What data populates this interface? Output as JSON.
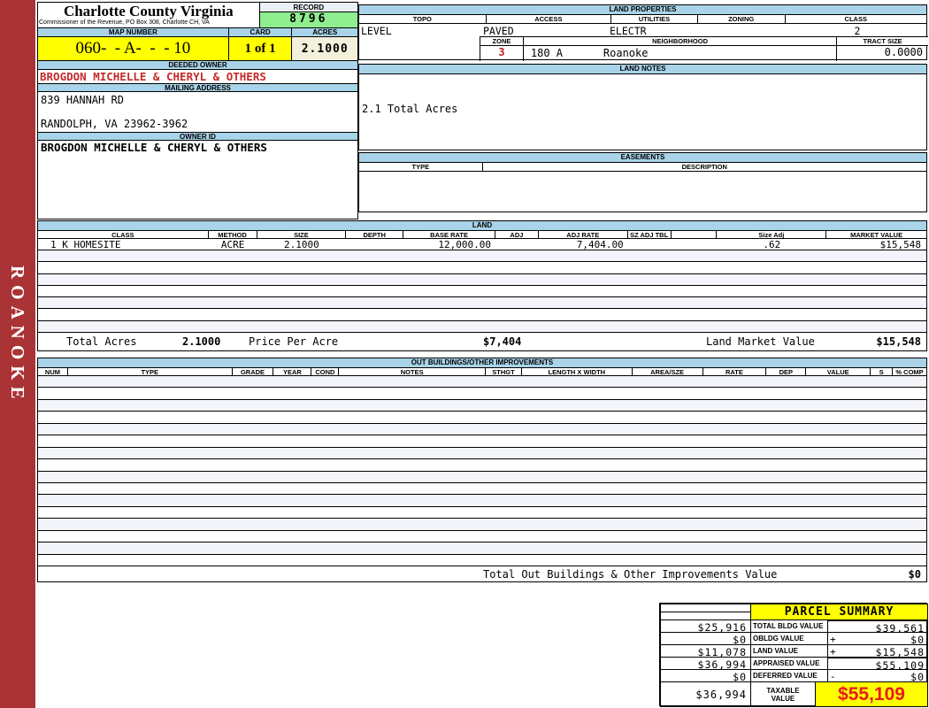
{
  "sidebar": {
    "label": "ROANOKE",
    "color": "#A93335"
  },
  "header": {
    "county": "Charlotte County Virginia",
    "commissioner": "Commissioner of the Revenue, PO Box 308, Charlotte CH, VA",
    "record_label": "RECORD",
    "record_value": "8796",
    "map_number_label": "MAP NUMBER",
    "map_number_value": "060-  - A-  -  - 10",
    "card_label": "CARD",
    "card_value": "1 of 1",
    "acres_label": "ACRES",
    "acres_value": "2.1000",
    "record_value_bg": "#90EE90",
    "map_value_bg": "#FFFF00"
  },
  "owner": {
    "deeded_owner_label": "DEEDED OWNER",
    "deeded_owner": "BROGDON MICHELLE & CHERYL & OTHERS",
    "mailing_address_label": "MAILING ADDRESS",
    "address_line1": "839 HANNAH RD",
    "address_line2": "RANDOLPH, VA 23962-3962",
    "owner_id_label": "OWNER ID",
    "owner_id": "BROGDON MICHELLE & CHERYL & OTHERS",
    "owner_color": "#C42A2A"
  },
  "land_properties": {
    "title": "LAND PROPERTIES",
    "columns": [
      "TOPO",
      "ACCESS",
      "UTILITIES",
      "ZONING",
      "CLASS"
    ],
    "topo": "LEVEL",
    "access": "PAVED",
    "utilities": "ELECTR",
    "zoning": "",
    "class": "2",
    "zone_label": "ZONE",
    "zone_value": "3",
    "zone_color": "#C02020",
    "neighborhood_label": "NEIGHBORHOOD",
    "neighborhood_code": "180 A",
    "neighborhood_name": "Roanoke",
    "tract_size_label": "TRACT SIZE",
    "tract_size": "0.0000"
  },
  "land_notes": {
    "title": "LAND NOTES",
    "note": "2.1 Total Acres"
  },
  "easements": {
    "title": "EASEMENTS",
    "type_label": "TYPE",
    "description_label": "DESCRIPTION"
  },
  "land": {
    "title": "LAND",
    "columns": [
      "CLASS",
      "METHOD",
      "SIZE",
      "DEPTH",
      "BASE RATE",
      "ADJ",
      "ADJ RATE",
      "SZ ADJ TBL",
      "",
      "Size Adj",
      "MARKET VALUE"
    ],
    "rows": [
      [
        "1 K HOMESITE",
        "ACRE",
        "2.1000",
        "",
        "12,000.00",
        "",
        "7,404.00",
        "",
        "",
        ".62",
        "$15,548"
      ]
    ],
    "total_acres_label": "Total Acres",
    "total_acres": "2.1000",
    "price_per_acre_label": "Price Per Acre",
    "price_per_acre": "$7,404",
    "market_value_label": "Land Market Value",
    "market_value": "$15,548"
  },
  "out_buildings": {
    "title": "OUT BUILDINGS/OTHER IMPROVEMENTS",
    "columns": [
      "NUM",
      "TYPE",
      "GRADE",
      "YEAR",
      "COND",
      "NOTES",
      "STHGT",
      "LENGTH X WIDTH",
      "AREA/SZE",
      "RATE",
      "DEP",
      "VALUE",
      "S",
      "% COMP"
    ],
    "total_label": "Total Out Buildings & Other Improvements Value",
    "total_value": "$0"
  },
  "parcel_summary": {
    "title": "PARCEL SUMMARY",
    "rows": [
      {
        "prior": "$25,916",
        "label": "TOTAL BLDG VALUE",
        "op": "",
        "value": "$39,561"
      },
      {
        "prior": "$0",
        "label": "OBLDG VALUE",
        "op": "+",
        "value": "$0"
      },
      {
        "prior": "$11,078",
        "label": "LAND VALUE",
        "op": "+",
        "value": "$15,548"
      },
      {
        "prior": "$36,994",
        "label": "APPRAISED VALUE",
        "op": "",
        "value": "$55,109"
      },
      {
        "prior": "$0",
        "label": "DEFERRED VALUE",
        "op": "-",
        "value": "$0"
      }
    ],
    "taxable": {
      "prior": "$36,994",
      "label": "TAXABLE VALUE",
      "value": "$55,109",
      "value_color": "#E81A1A"
    }
  }
}
